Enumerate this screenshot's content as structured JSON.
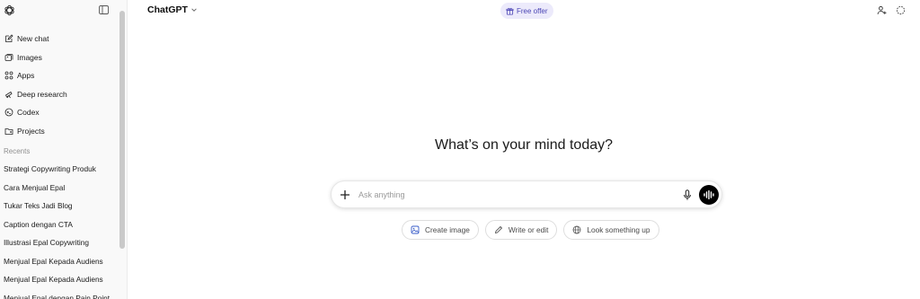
{
  "sidebar": {
    "logo_icon": "openai-logo-icon",
    "toggle_icon": "sidebar-toggle-icon",
    "menu": [
      {
        "label": "New chat",
        "icon": "edit-icon"
      },
      {
        "label": "Images",
        "icon": "images-icon"
      },
      {
        "label": "Apps",
        "icon": "apps-grid-icon"
      },
      {
        "label": "Deep research",
        "icon": "telescope-icon"
      },
      {
        "label": "Codex",
        "icon": "codex-icon"
      },
      {
        "label": "Projects",
        "icon": "folder-icon"
      }
    ],
    "recents_label": "Recents",
    "recents": [
      "Strategi Copywriting Produk",
      "Cara Menjual Epal",
      "Tukar Teks Jadi Blog",
      "Caption dengan CTA",
      "Illustrasi Epal Copywriting",
      "Menjual Epal Kepada Audiens",
      "Menjual Epal Kepada Audiens",
      "Menjual Epal dengan Pain Point"
    ]
  },
  "header": {
    "model_label": "ChatGPT",
    "offer_label": "Free offer",
    "offer_icon": "gift-icon",
    "right_icons": [
      "add-person-icon",
      "temporary-chat-icon"
    ]
  },
  "main": {
    "headline": "What’s on your mind today?",
    "composer": {
      "placeholder": "Ask anything",
      "value": ""
    },
    "chips": [
      {
        "label": "Create image",
        "icon": "image-icon"
      },
      {
        "label": "Write or edit",
        "icon": "pencil-icon"
      },
      {
        "label": "Look something up",
        "icon": "globe-icon"
      }
    ]
  },
  "colors": {
    "sidebar_bg": "#f9f9f9",
    "offer_bg": "#eceafb",
    "offer_text": "#4b45b5",
    "voice_button": "#000000"
  }
}
